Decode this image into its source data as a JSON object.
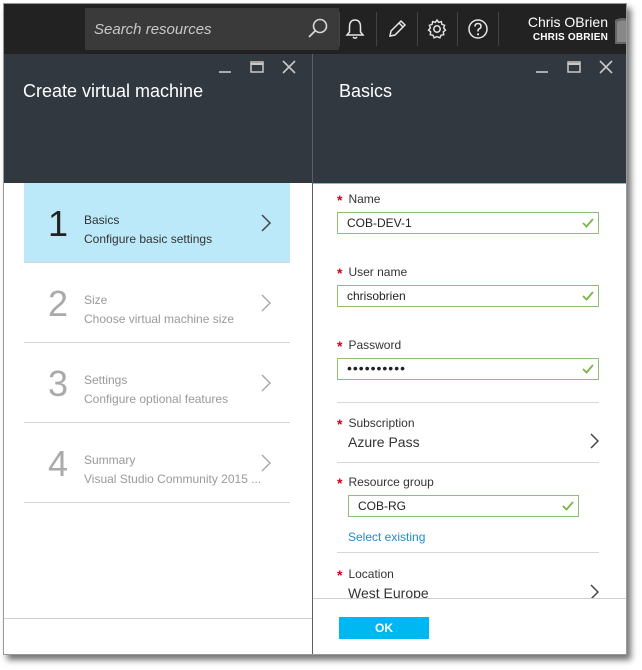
{
  "search": {
    "placeholder": "Search resources"
  },
  "user": {
    "name": "Chris OBrien",
    "account": "CHRIS OBRIEN"
  },
  "left_blade": {
    "title": "Create virtual machine",
    "steps": [
      {
        "number": "1",
        "title": "Basics",
        "subtitle": "Configure basic settings"
      },
      {
        "number": "2",
        "title": "Size",
        "subtitle": "Choose virtual machine size"
      },
      {
        "number": "3",
        "title": "Settings",
        "subtitle": "Configure optional features"
      },
      {
        "number": "4",
        "title": "Summary",
        "subtitle": "Visual Studio Community 2015 ..."
      }
    ]
  },
  "right_blade": {
    "title": "Basics",
    "required_marker": "*",
    "name": {
      "label": "Name",
      "value": "COB-DEV-1"
    },
    "username": {
      "label": "User name",
      "value": "chrisobrien"
    },
    "password": {
      "label": "Password",
      "value": "••••••••••"
    },
    "subscription": {
      "label": "Subscription",
      "value": "Azure Pass"
    },
    "resource_group": {
      "label": "Resource group",
      "value": "COB-RG",
      "link": "Select existing"
    },
    "location": {
      "label": "Location",
      "value": "West Europe"
    },
    "ok_label": "OK"
  },
  "colors": {
    "topbar": "#222222",
    "blade_header": "#32383f",
    "active_step": "#bbe9f9",
    "accent": "#00b8f1",
    "required": "#d0021b",
    "valid_check": "#7ab648"
  }
}
